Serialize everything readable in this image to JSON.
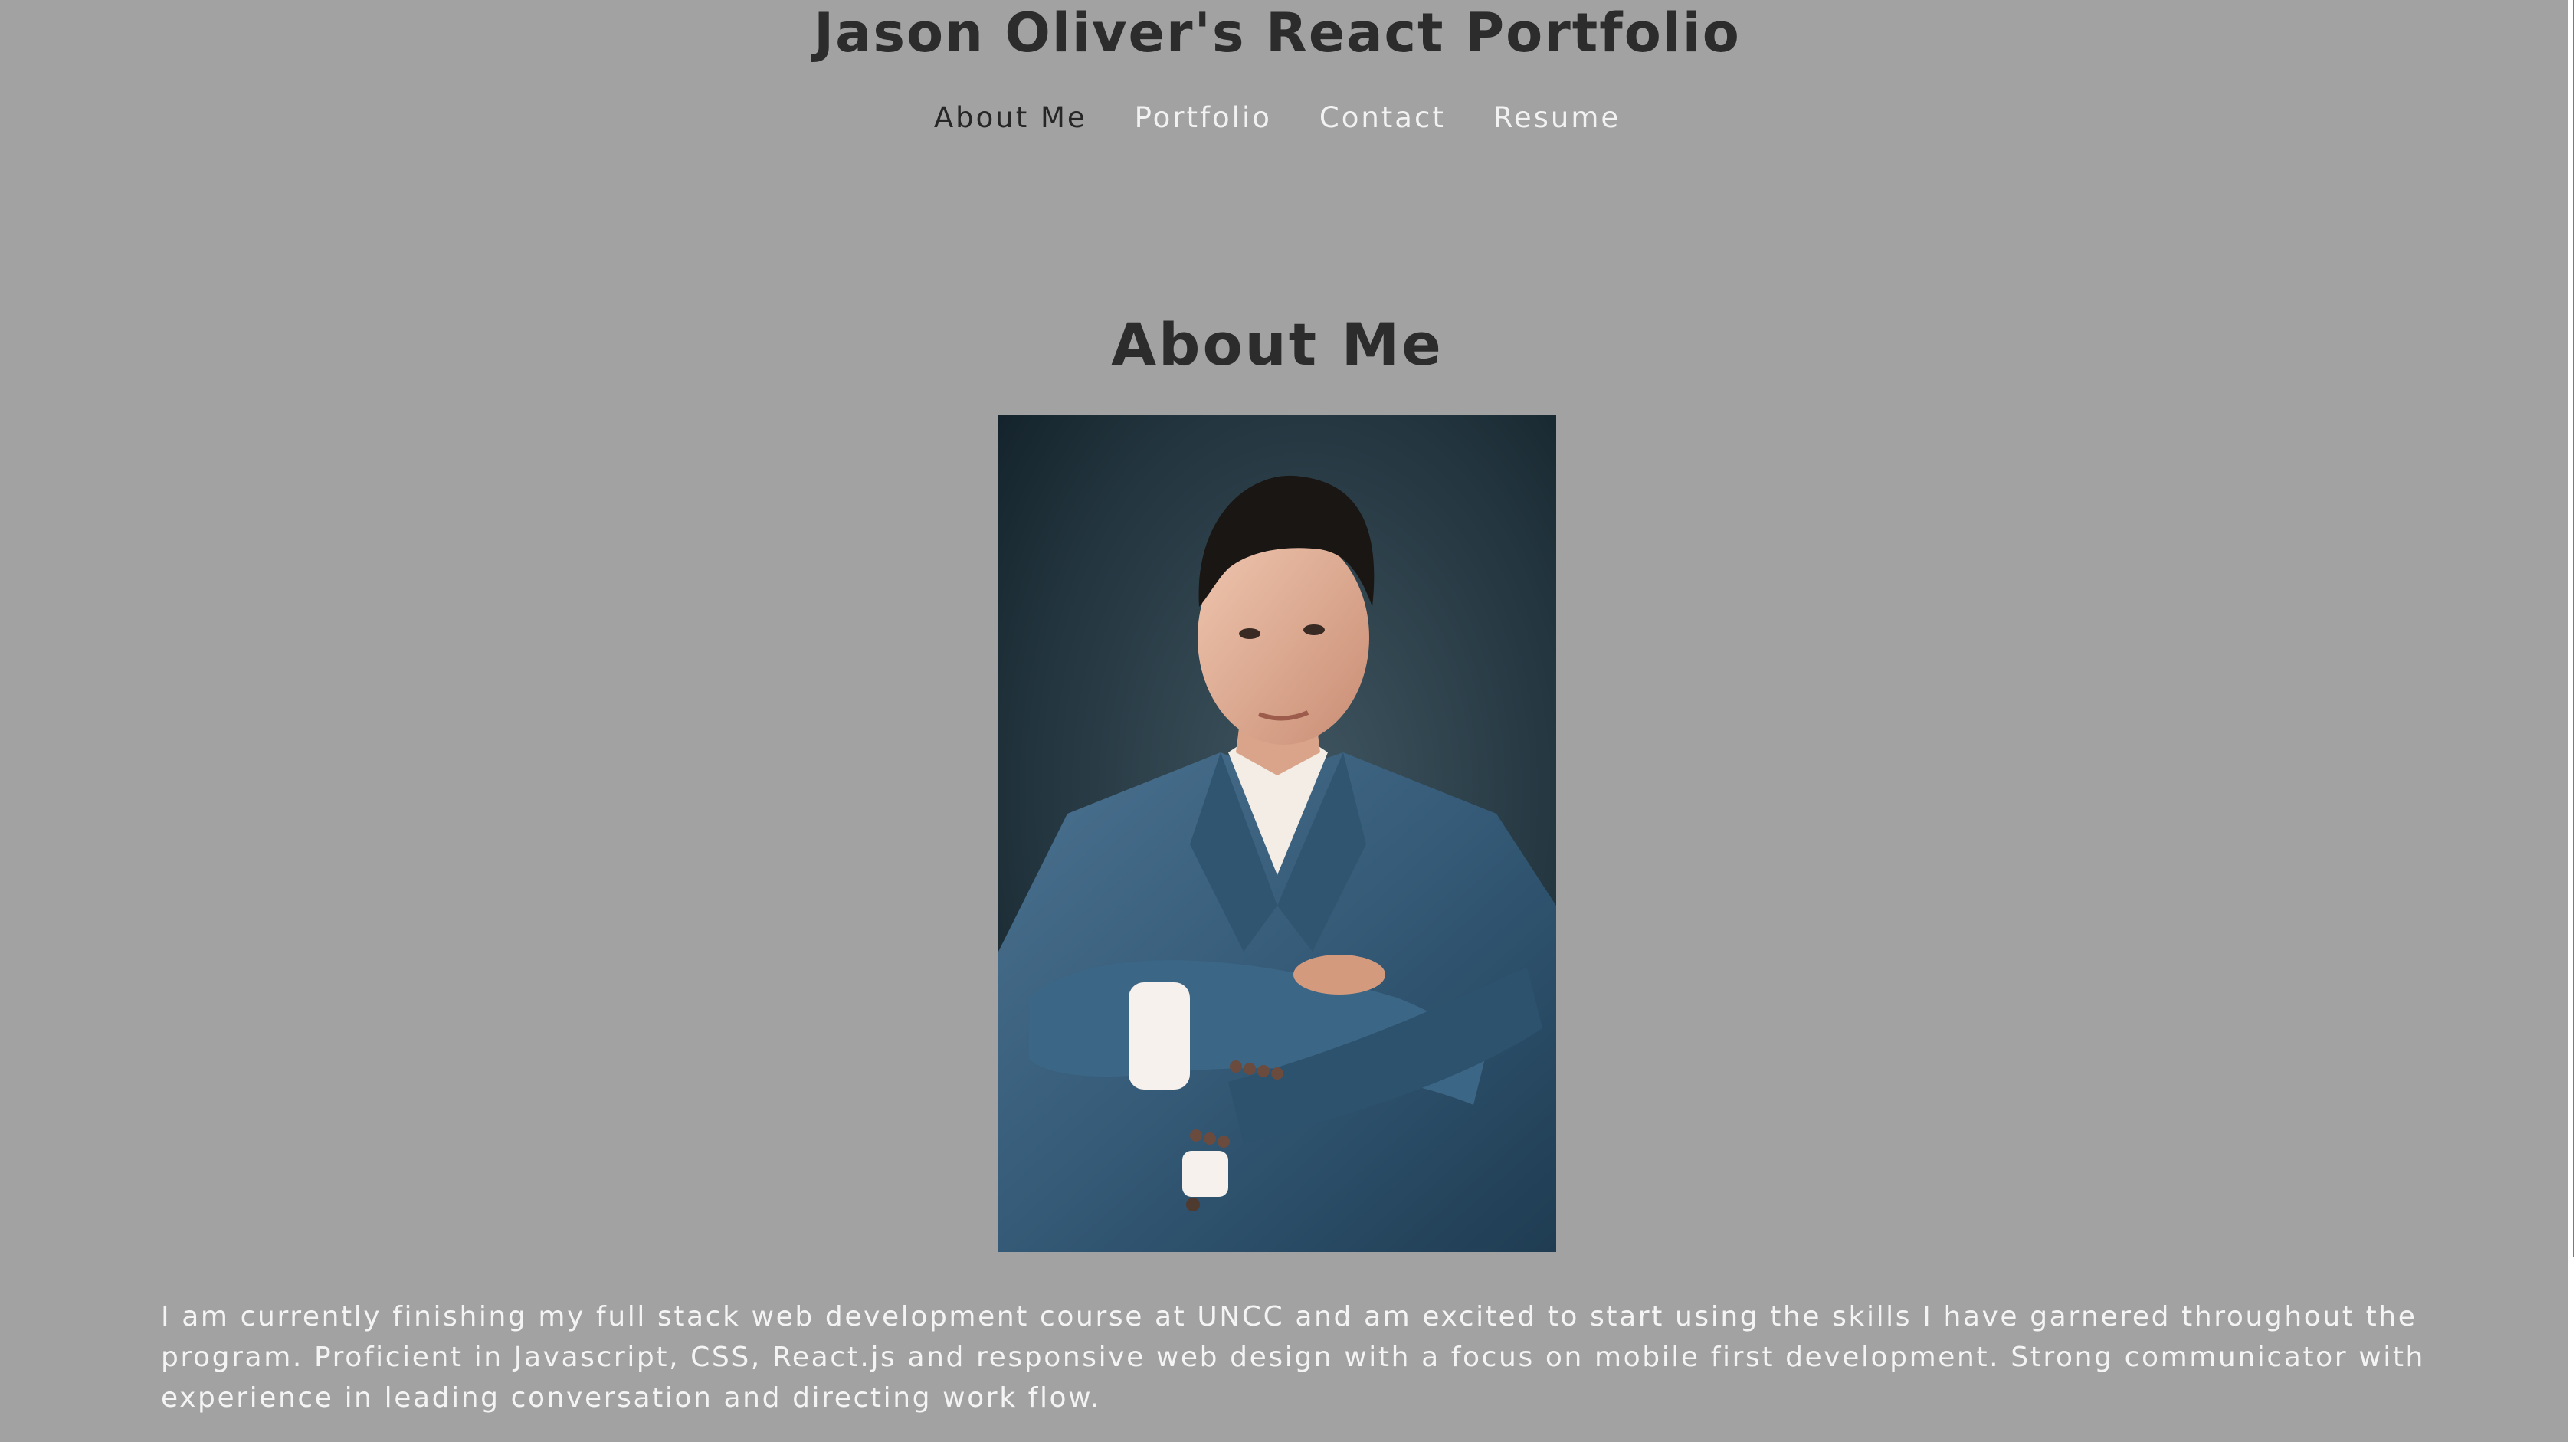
{
  "header": {
    "title": "Jason Oliver's React Portfolio"
  },
  "nav": {
    "items": [
      {
        "label": "About Me",
        "active": true
      },
      {
        "label": "Portfolio",
        "active": false
      },
      {
        "label": "Contact",
        "active": false
      },
      {
        "label": "Resume",
        "active": false
      }
    ]
  },
  "about": {
    "heading": "About Me",
    "photo_icon": "portrait-photo",
    "bio": "I am currently finishing my full stack web development course at UNCC and am excited to start using the skills I have garnered throughout the program. Proficient in Javascript, CSS, React.js and responsive web design with a focus on mobile first development. Strong communicator with experience in leading conversation and directing work flow."
  },
  "colors": {
    "background": "#a2a2a2",
    "heading_text": "#2c2c2c",
    "nav_text": "#f2f2f2",
    "nav_active": "#262626",
    "bio_text": "#f4f4f4"
  }
}
